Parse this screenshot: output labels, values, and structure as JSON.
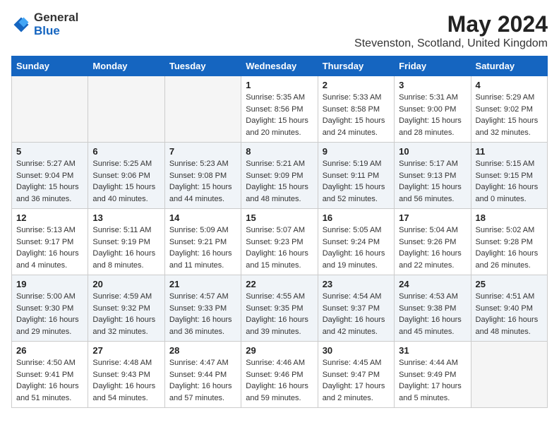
{
  "header": {
    "logo_general": "General",
    "logo_blue": "Blue",
    "title": "May 2024",
    "subtitle": "Stevenston, Scotland, United Kingdom"
  },
  "weekdays": [
    "Sunday",
    "Monday",
    "Tuesday",
    "Wednesday",
    "Thursday",
    "Friday",
    "Saturday"
  ],
  "weeks": [
    [
      {
        "day": "",
        "info": "",
        "empty": true
      },
      {
        "day": "",
        "info": "",
        "empty": true
      },
      {
        "day": "",
        "info": "",
        "empty": true
      },
      {
        "day": "1",
        "info": "Sunrise: 5:35 AM\nSunset: 8:56 PM\nDaylight: 15 hours\nand 20 minutes.",
        "empty": false
      },
      {
        "day": "2",
        "info": "Sunrise: 5:33 AM\nSunset: 8:58 PM\nDaylight: 15 hours\nand 24 minutes.",
        "empty": false
      },
      {
        "day": "3",
        "info": "Sunrise: 5:31 AM\nSunset: 9:00 PM\nDaylight: 15 hours\nand 28 minutes.",
        "empty": false
      },
      {
        "day": "4",
        "info": "Sunrise: 5:29 AM\nSunset: 9:02 PM\nDaylight: 15 hours\nand 32 minutes.",
        "empty": false
      }
    ],
    [
      {
        "day": "5",
        "info": "Sunrise: 5:27 AM\nSunset: 9:04 PM\nDaylight: 15 hours\nand 36 minutes.",
        "empty": false
      },
      {
        "day": "6",
        "info": "Sunrise: 5:25 AM\nSunset: 9:06 PM\nDaylight: 15 hours\nand 40 minutes.",
        "empty": false
      },
      {
        "day": "7",
        "info": "Sunrise: 5:23 AM\nSunset: 9:08 PM\nDaylight: 15 hours\nand 44 minutes.",
        "empty": false
      },
      {
        "day": "8",
        "info": "Sunrise: 5:21 AM\nSunset: 9:09 PM\nDaylight: 15 hours\nand 48 minutes.",
        "empty": false
      },
      {
        "day": "9",
        "info": "Sunrise: 5:19 AM\nSunset: 9:11 PM\nDaylight: 15 hours\nand 52 minutes.",
        "empty": false
      },
      {
        "day": "10",
        "info": "Sunrise: 5:17 AM\nSunset: 9:13 PM\nDaylight: 15 hours\nand 56 minutes.",
        "empty": false
      },
      {
        "day": "11",
        "info": "Sunrise: 5:15 AM\nSunset: 9:15 PM\nDaylight: 16 hours\nand 0 minutes.",
        "empty": false
      }
    ],
    [
      {
        "day": "12",
        "info": "Sunrise: 5:13 AM\nSunset: 9:17 PM\nDaylight: 16 hours\nand 4 minutes.",
        "empty": false
      },
      {
        "day": "13",
        "info": "Sunrise: 5:11 AM\nSunset: 9:19 PM\nDaylight: 16 hours\nand 8 minutes.",
        "empty": false
      },
      {
        "day": "14",
        "info": "Sunrise: 5:09 AM\nSunset: 9:21 PM\nDaylight: 16 hours\nand 11 minutes.",
        "empty": false
      },
      {
        "day": "15",
        "info": "Sunrise: 5:07 AM\nSunset: 9:23 PM\nDaylight: 16 hours\nand 15 minutes.",
        "empty": false
      },
      {
        "day": "16",
        "info": "Sunrise: 5:05 AM\nSunset: 9:24 PM\nDaylight: 16 hours\nand 19 minutes.",
        "empty": false
      },
      {
        "day": "17",
        "info": "Sunrise: 5:04 AM\nSunset: 9:26 PM\nDaylight: 16 hours\nand 22 minutes.",
        "empty": false
      },
      {
        "day": "18",
        "info": "Sunrise: 5:02 AM\nSunset: 9:28 PM\nDaylight: 16 hours\nand 26 minutes.",
        "empty": false
      }
    ],
    [
      {
        "day": "19",
        "info": "Sunrise: 5:00 AM\nSunset: 9:30 PM\nDaylight: 16 hours\nand 29 minutes.",
        "empty": false
      },
      {
        "day": "20",
        "info": "Sunrise: 4:59 AM\nSunset: 9:32 PM\nDaylight: 16 hours\nand 32 minutes.",
        "empty": false
      },
      {
        "day": "21",
        "info": "Sunrise: 4:57 AM\nSunset: 9:33 PM\nDaylight: 16 hours\nand 36 minutes.",
        "empty": false
      },
      {
        "day": "22",
        "info": "Sunrise: 4:55 AM\nSunset: 9:35 PM\nDaylight: 16 hours\nand 39 minutes.",
        "empty": false
      },
      {
        "day": "23",
        "info": "Sunrise: 4:54 AM\nSunset: 9:37 PM\nDaylight: 16 hours\nand 42 minutes.",
        "empty": false
      },
      {
        "day": "24",
        "info": "Sunrise: 4:53 AM\nSunset: 9:38 PM\nDaylight: 16 hours\nand 45 minutes.",
        "empty": false
      },
      {
        "day": "25",
        "info": "Sunrise: 4:51 AM\nSunset: 9:40 PM\nDaylight: 16 hours\nand 48 minutes.",
        "empty": false
      }
    ],
    [
      {
        "day": "26",
        "info": "Sunrise: 4:50 AM\nSunset: 9:41 PM\nDaylight: 16 hours\nand 51 minutes.",
        "empty": false
      },
      {
        "day": "27",
        "info": "Sunrise: 4:48 AM\nSunset: 9:43 PM\nDaylight: 16 hours\nand 54 minutes.",
        "empty": false
      },
      {
        "day": "28",
        "info": "Sunrise: 4:47 AM\nSunset: 9:44 PM\nDaylight: 16 hours\nand 57 minutes.",
        "empty": false
      },
      {
        "day": "29",
        "info": "Sunrise: 4:46 AM\nSunset: 9:46 PM\nDaylight: 16 hours\nand 59 minutes.",
        "empty": false
      },
      {
        "day": "30",
        "info": "Sunrise: 4:45 AM\nSunset: 9:47 PM\nDaylight: 17 hours\nand 2 minutes.",
        "empty": false
      },
      {
        "day": "31",
        "info": "Sunrise: 4:44 AM\nSunset: 9:49 PM\nDaylight: 17 hours\nand 5 minutes.",
        "empty": false
      },
      {
        "day": "",
        "info": "",
        "empty": true
      }
    ]
  ]
}
